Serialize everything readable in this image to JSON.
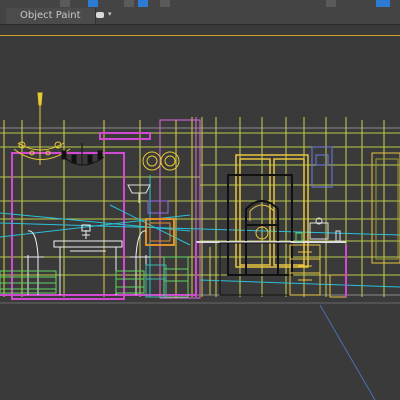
{
  "ribbon": {
    "tab_label": "Object Paint",
    "toggle_icon": "eye-toggle-icon",
    "dropdown_icon": "chevron-down-icon"
  },
  "toolbar": {
    "icons": [
      "select-icon",
      "move-icon",
      "rotate-icon",
      "scale-icon",
      "snap-icon",
      "settings-icon"
    ]
  },
  "viewport": {
    "frame_color": "#c9a227",
    "background": "#3a3a3a"
  }
}
